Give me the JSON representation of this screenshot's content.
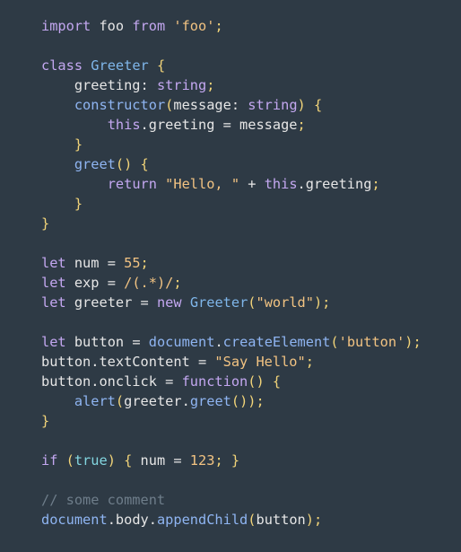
{
  "colors": {
    "background": "#2e3a45",
    "keyword": "#c3a7f0",
    "class_name": "#7fb6ea",
    "string": "#f2c382",
    "function": "#8fb5f2",
    "boolean": "#83d6e0",
    "number": "#f2c382",
    "punctuation": "#f2d479",
    "comment": "#6e7d8a",
    "plain": "#e6e6e6"
  },
  "code_lines": [
    [
      {
        "t": "import",
        "c": "keyword"
      },
      {
        "t": " foo ",
        "c": "plain"
      },
      {
        "t": "from",
        "c": "keyword"
      },
      {
        "t": " ",
        "c": "plain"
      },
      {
        "t": "'foo'",
        "c": "string"
      },
      {
        "t": ";",
        "c": "punctuation"
      }
    ],
    [],
    [
      {
        "t": "class",
        "c": "keyword"
      },
      {
        "t": " ",
        "c": "plain"
      },
      {
        "t": "Greeter",
        "c": "class_name"
      },
      {
        "t": " {",
        "c": "punctuation"
      }
    ],
    [
      {
        "t": "    greeting: ",
        "c": "plain"
      },
      {
        "t": "string",
        "c": "keyword"
      },
      {
        "t": ";",
        "c": "punctuation"
      }
    ],
    [
      {
        "t": "    ",
        "c": "plain"
      },
      {
        "t": "constructor",
        "c": "function"
      },
      {
        "t": "(",
        "c": "punctuation"
      },
      {
        "t": "message: ",
        "c": "plain"
      },
      {
        "t": "string",
        "c": "keyword"
      },
      {
        "t": ") {",
        "c": "punctuation"
      }
    ],
    [
      {
        "t": "        ",
        "c": "plain"
      },
      {
        "t": "this",
        "c": "keyword"
      },
      {
        "t": ".greeting = message",
        "c": "plain"
      },
      {
        "t": ";",
        "c": "punctuation"
      }
    ],
    [
      {
        "t": "    }",
        "c": "punctuation"
      }
    ],
    [
      {
        "t": "    ",
        "c": "plain"
      },
      {
        "t": "greet",
        "c": "function"
      },
      {
        "t": "() {",
        "c": "punctuation"
      }
    ],
    [
      {
        "t": "        ",
        "c": "plain"
      },
      {
        "t": "return",
        "c": "keyword"
      },
      {
        "t": " ",
        "c": "plain"
      },
      {
        "t": "\"Hello, \"",
        "c": "string"
      },
      {
        "t": " + ",
        "c": "plain"
      },
      {
        "t": "this",
        "c": "keyword"
      },
      {
        "t": ".greeting",
        "c": "plain"
      },
      {
        "t": ";",
        "c": "punctuation"
      }
    ],
    [
      {
        "t": "    }",
        "c": "punctuation"
      }
    ],
    [
      {
        "t": "}",
        "c": "punctuation"
      }
    ],
    [],
    [
      {
        "t": "let",
        "c": "keyword"
      },
      {
        "t": " num = ",
        "c": "plain"
      },
      {
        "t": "55",
        "c": "number"
      },
      {
        "t": ";",
        "c": "punctuation"
      }
    ],
    [
      {
        "t": "let",
        "c": "keyword"
      },
      {
        "t": " exp = ",
        "c": "plain"
      },
      {
        "t": "/(.*)/",
        "c": "string"
      },
      {
        "t": ";",
        "c": "punctuation"
      }
    ],
    [
      {
        "t": "let",
        "c": "keyword"
      },
      {
        "t": " greeter = ",
        "c": "plain"
      },
      {
        "t": "new",
        "c": "keyword"
      },
      {
        "t": " ",
        "c": "plain"
      },
      {
        "t": "Greeter",
        "c": "class_name"
      },
      {
        "t": "(",
        "c": "punctuation"
      },
      {
        "t": "\"world\"",
        "c": "string"
      },
      {
        "t": ");",
        "c": "punctuation"
      }
    ],
    [],
    [
      {
        "t": "let",
        "c": "keyword"
      },
      {
        "t": " button = ",
        "c": "plain"
      },
      {
        "t": "document",
        "c": "function"
      },
      {
        "t": ".",
        "c": "plain"
      },
      {
        "t": "createElement",
        "c": "function"
      },
      {
        "t": "(",
        "c": "punctuation"
      },
      {
        "t": "'button'",
        "c": "string"
      },
      {
        "t": ");",
        "c": "punctuation"
      }
    ],
    [
      {
        "t": "button.textContent = ",
        "c": "plain"
      },
      {
        "t": "\"Say Hello\"",
        "c": "string"
      },
      {
        "t": ";",
        "c": "punctuation"
      }
    ],
    [
      {
        "t": "button.onclick = ",
        "c": "plain"
      },
      {
        "t": "function",
        "c": "keyword"
      },
      {
        "t": "() {",
        "c": "punctuation"
      }
    ],
    [
      {
        "t": "    ",
        "c": "plain"
      },
      {
        "t": "alert",
        "c": "function"
      },
      {
        "t": "(",
        "c": "punctuation"
      },
      {
        "t": "greeter.",
        "c": "plain"
      },
      {
        "t": "greet",
        "c": "function"
      },
      {
        "t": "());",
        "c": "punctuation"
      }
    ],
    [
      {
        "t": "}",
        "c": "punctuation"
      }
    ],
    [],
    [
      {
        "t": "if",
        "c": "keyword"
      },
      {
        "t": " (",
        "c": "punctuation"
      },
      {
        "t": "true",
        "c": "boolean"
      },
      {
        "t": ") { ",
        "c": "punctuation"
      },
      {
        "t": "num = ",
        "c": "plain"
      },
      {
        "t": "123",
        "c": "number"
      },
      {
        "t": "; }",
        "c": "punctuation"
      }
    ],
    [],
    [
      {
        "t": "// some comment",
        "c": "comment"
      }
    ],
    [
      {
        "t": "document",
        "c": "function"
      },
      {
        "t": ".body.",
        "c": "plain"
      },
      {
        "t": "appendChild",
        "c": "function"
      },
      {
        "t": "(",
        "c": "punctuation"
      },
      {
        "t": "button",
        "c": "plain"
      },
      {
        "t": ");",
        "c": "punctuation"
      }
    ]
  ]
}
